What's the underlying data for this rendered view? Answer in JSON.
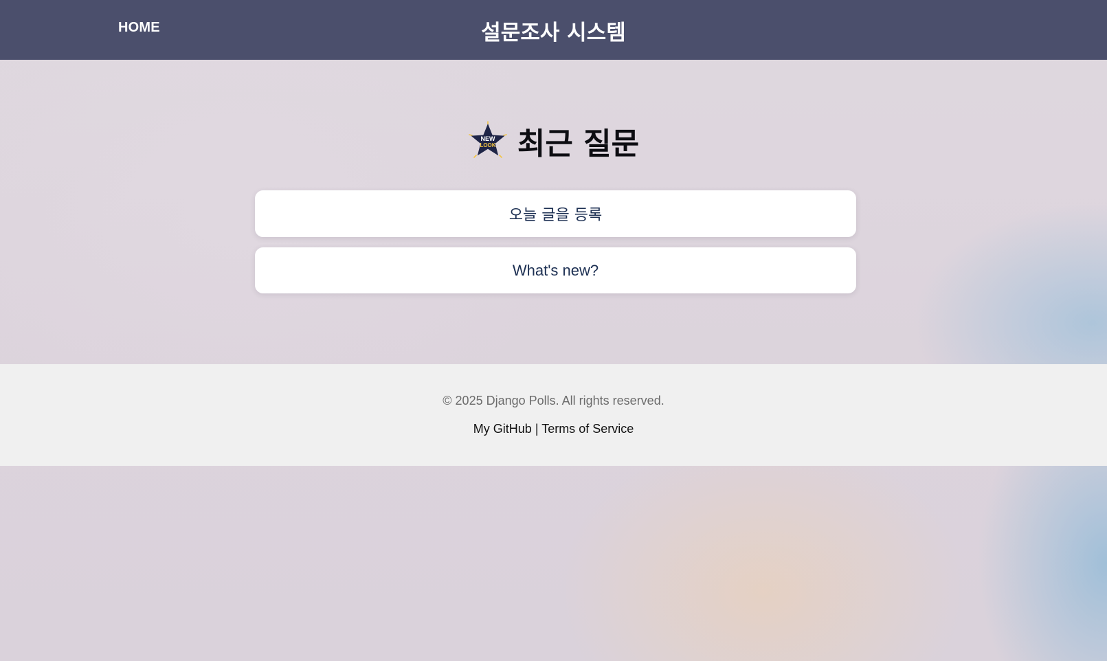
{
  "nav": {
    "home_label": "HOME",
    "title": "설문조사 시스템"
  },
  "main": {
    "heading": "최근 질문",
    "badge_icon": "new-look-star-icon",
    "badge_text_top": "NEW",
    "badge_text_bottom": "LOOK",
    "questions": [
      {
        "label": "오늘 글을 등록"
      },
      {
        "label": "What's new?"
      }
    ]
  },
  "footer": {
    "copyright": "© 2025 Django Polls. All rights reserved.",
    "link_github": "My GitHub",
    "separator": "|",
    "link_terms": "Terms of Service"
  },
  "colors": {
    "navbar": "#4b4f6c",
    "footer_bg": "#f0f0f0",
    "card_text": "#1c2f52",
    "badge_star": "#1f2547",
    "badge_accent": "#f3c443"
  }
}
